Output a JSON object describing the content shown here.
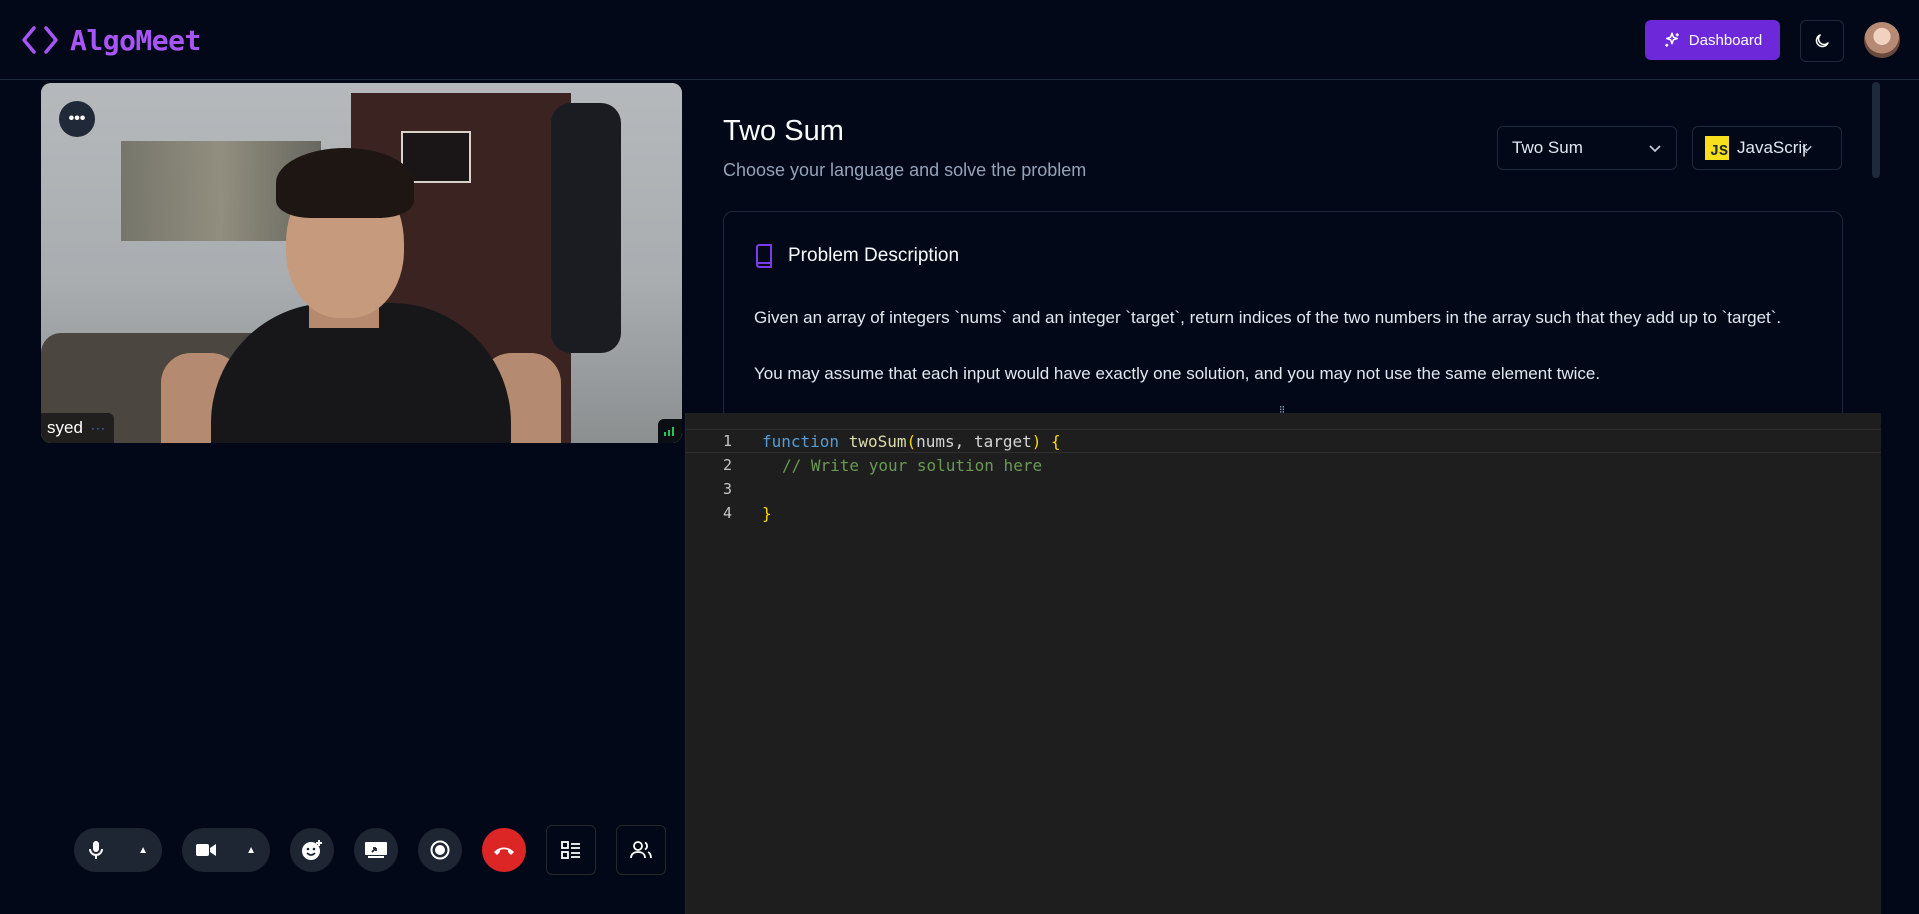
{
  "header": {
    "brand": "AlgoMeet",
    "dashboard_label": "Dashboard",
    "icons": {
      "logo": "code-brackets-icon",
      "dashboard": "sparkles-icon",
      "theme": "moon-icon"
    }
  },
  "video": {
    "participant_name": "syed",
    "participant_dots": "···",
    "menu_label": "•••"
  },
  "controls": {
    "items": [
      "mic-icon",
      "camera-icon",
      "reaction-icon",
      "screen-share-icon",
      "record-icon",
      "end-call-icon",
      "layout-icon",
      "participants-icon"
    ]
  },
  "problem": {
    "title": "Two Sum",
    "subtitle": "Choose your language and solve the problem",
    "selected_problem": "Two Sum",
    "selected_language": "JavaScript",
    "language_badge": "JS",
    "description_heading": "Problem Description",
    "description_paragraphs": [
      "Given an array of integers `nums` and an integer `target`, return indices of the two numbers in the array such that they add up to `target`.",
      "You may assume that each input would have exactly one solution, and you may not use the same element twice."
    ]
  },
  "editor": {
    "line_numbers": [
      "1",
      "2",
      "3",
      "4"
    ],
    "line1": {
      "keyword": "function",
      "name": "twoSum",
      "open_paren": "(",
      "params": "nums, target",
      "close_paren": ")",
      "brace": "{"
    },
    "line2": "// Write your solution here",
    "line4": "}"
  },
  "colors": {
    "accent": "#6d28d9",
    "brand_text": "#a855f7",
    "end_call": "#dc2626",
    "background": "#020817",
    "editor_bg": "#1e1e1e"
  }
}
